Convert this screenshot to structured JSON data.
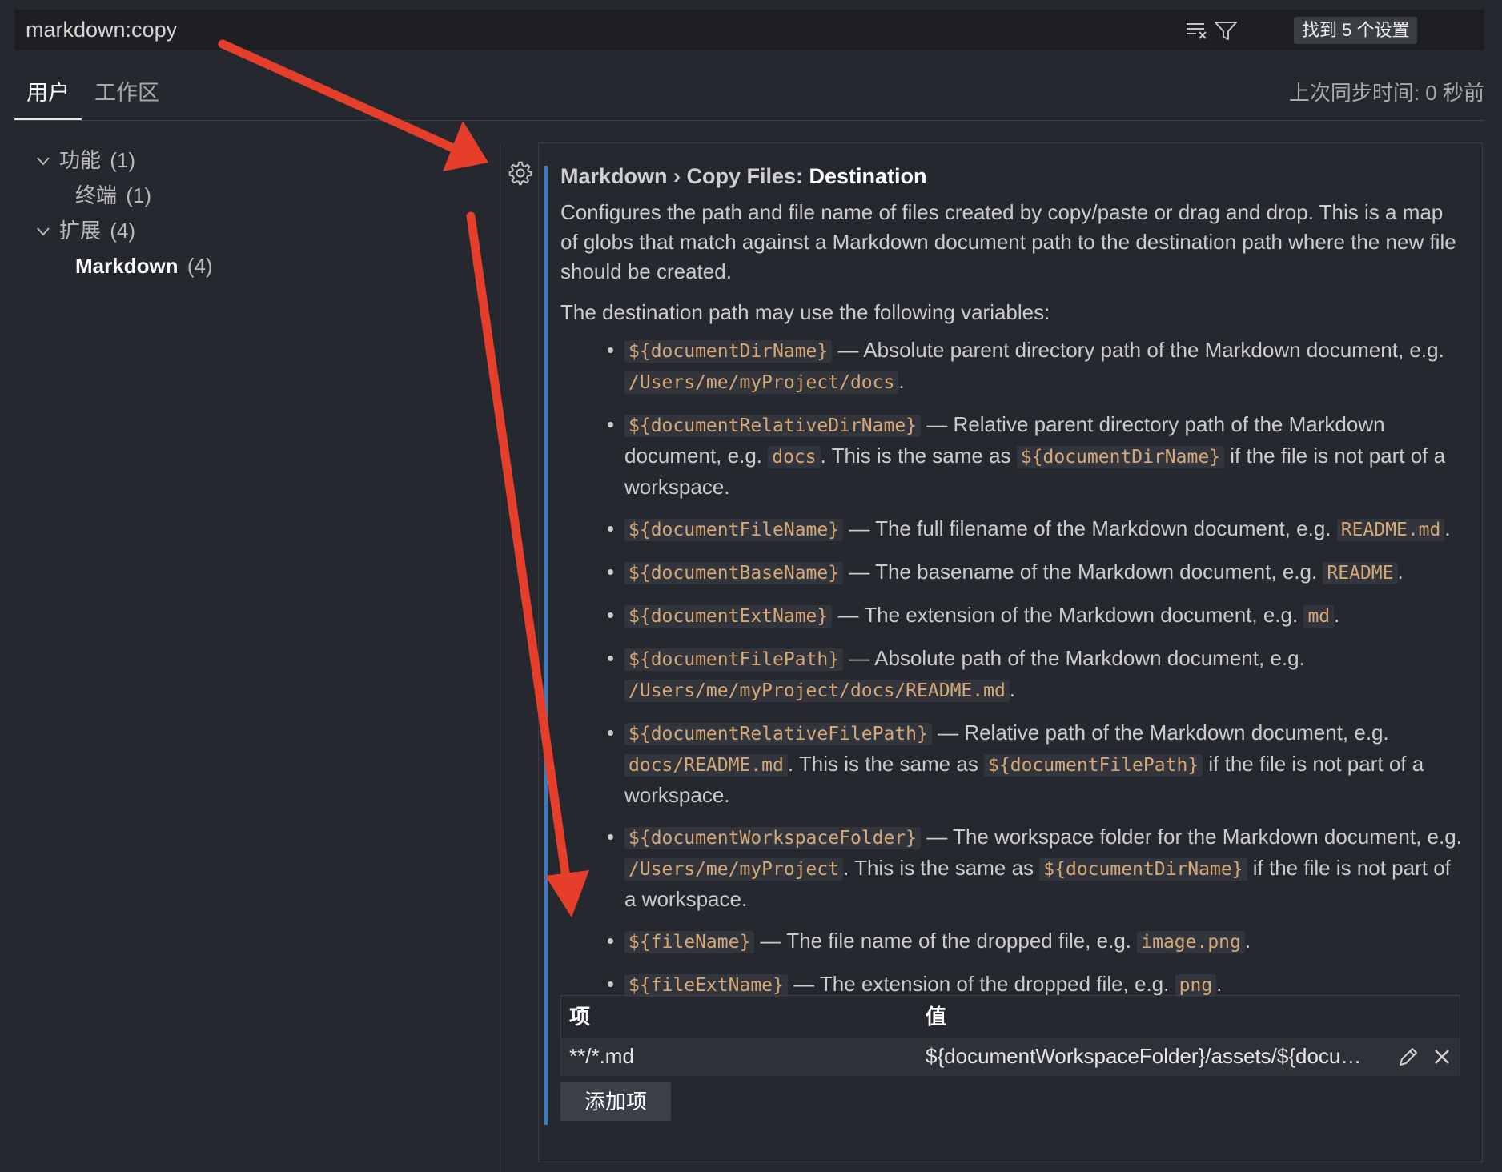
{
  "search": {
    "value": "markdown:copy",
    "result_count": "找到 5 个设置",
    "icons": [
      "clear-filter-icon",
      "filter-icon"
    ]
  },
  "tabs": [
    {
      "label": "用户",
      "active": true
    },
    {
      "label": "工作区",
      "active": false
    }
  ],
  "sync_status": "上次同步时间: 0 秒前",
  "tree": [
    {
      "label": "功能",
      "count": "(1)",
      "expanded": true
    },
    {
      "label": "终端",
      "count": "(1)"
    },
    {
      "label": "扩展",
      "count": "(4)",
      "expanded": true
    },
    {
      "label": "Markdown",
      "count": "(4)",
      "selected": true
    }
  ],
  "setting": {
    "breadcrumb": "Markdown › Copy Files: ",
    "name": "Destination",
    "description": "Configures the path and file name of files created by copy/paste or drag and drop. This is a map of globs that match against a Markdown document path to the destination path where the new file should be created.",
    "variables_intro": "The destination path may use the following variables:",
    "variables": [
      {
        "var": "${documentDirName}",
        "t1": " — Absolute parent directory path of the Markdown document, e.g. ",
        "ex1": "/Users/me/myProject/docs",
        "t2": ".",
        "ex2": "",
        "t3": ""
      },
      {
        "var": "${documentRelativeDirName}",
        "t1": " — Relative parent directory path of the Markdown document, e.g. ",
        "ex1": "docs",
        "t2": ". This is the same as ",
        "ex2": "${documentDirName}",
        "t3": " if the file is not part of a workspace."
      },
      {
        "var": "${documentFileName}",
        "t1": " — The full filename of the Markdown document, e.g. ",
        "ex1": "README.md",
        "t2": ".",
        "ex2": "",
        "t3": ""
      },
      {
        "var": "${documentBaseName}",
        "t1": " — The basename of the Markdown document, e.g. ",
        "ex1": "README",
        "t2": ".",
        "ex2": "",
        "t3": ""
      },
      {
        "var": "${documentExtName}",
        "t1": " — The extension of the Markdown document, e.g. ",
        "ex1": "md",
        "t2": ".",
        "ex2": "",
        "t3": ""
      },
      {
        "var": "${documentFilePath}",
        "t1": " — Absolute path of the Markdown document, e.g. ",
        "ex1": "/Users/me/myProject/docs/README.md",
        "t2": ".",
        "ex2": "",
        "t3": ""
      },
      {
        "var": "${documentRelativeFilePath}",
        "t1": " — Relative path of the Markdown document, e.g. ",
        "ex1": "docs/README.md",
        "t2": ". This is the same as ",
        "ex2": "${documentFilePath}",
        "t3": " if the file is not part of a workspace."
      },
      {
        "var": "${documentWorkspaceFolder}",
        "t1": " — The workspace folder for the Markdown document, e.g. ",
        "ex1": "/Users/me/myProject",
        "t2": ". This is the same as ",
        "ex2": "${documentDirName}",
        "t3": " if the file is not part of a workspace."
      },
      {
        "var": "${fileName}",
        "t1": " — The file name of the dropped file, e.g. ",
        "ex1": "image.png",
        "t2": ".",
        "ex2": "",
        "t3": ""
      },
      {
        "var": "${fileExtName}",
        "t1": " — The extension of the dropped file, e.g. ",
        "ex1": "png",
        "t2": ".",
        "ex2": "",
        "t3": ""
      }
    ],
    "table": {
      "headers": [
        "项",
        "值"
      ],
      "rows": [
        {
          "item": "**/*.md",
          "value": "${documentWorkspaceFolder}/assets/${docu…"
        }
      ]
    },
    "add_button": "添加项"
  },
  "colors": {
    "background": "#262830",
    "accent": "#3a7bc8",
    "code_text": "#d7a877",
    "annotation_arrow": "#e53e2a"
  }
}
